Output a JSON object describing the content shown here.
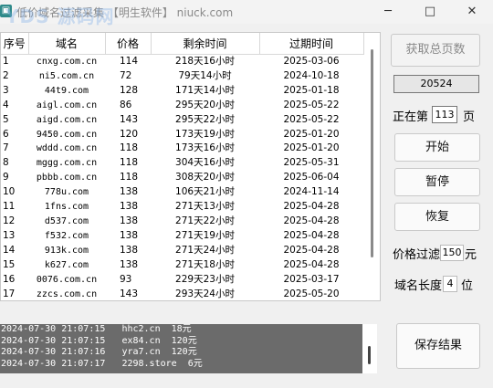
{
  "window": {
    "icon": "app-icon",
    "title": "低价域名过滤采集 【明生软件】 niuck.com",
    "watermark": "YDS 源码网",
    "min_glyph": "─",
    "max_glyph": "□",
    "close_glyph": "✕"
  },
  "table": {
    "headers": [
      "序号",
      "域名",
      "价格",
      "剩余时间",
      "过期时间"
    ],
    "rows": [
      [
        "1",
        "cnxg.com.cn",
        "114",
        "218天16小时",
        "2025-03-06"
      ],
      [
        "2",
        "ni5.com.cn",
        "72",
        "79天14小时",
        "2024-10-18"
      ],
      [
        "3",
        "44t9.com",
        "128",
        "171天14小时",
        "2025-01-18"
      ],
      [
        "4",
        "aigl.com.cn",
        "86",
        "295天20小时",
        "2025-05-22"
      ],
      [
        "5",
        "aigd.com.cn",
        "143",
        "295天22小时",
        "2025-05-22"
      ],
      [
        "6",
        "9450.com.cn",
        "120",
        "173天19小时",
        "2025-01-20"
      ],
      [
        "7",
        "wddd.com.cn",
        "118",
        "173天16小时",
        "2025-01-20"
      ],
      [
        "8",
        "mggg.com.cn",
        "118",
        "304天16小时",
        "2025-05-31"
      ],
      [
        "9",
        "pbbb.com.cn",
        "118",
        "308天20小时",
        "2025-06-04"
      ],
      [
        "10",
        "778u.com",
        "138",
        "106天21小时",
        "2024-11-14"
      ],
      [
        "11",
        "1fns.com",
        "138",
        "271天13小时",
        "2025-04-28"
      ],
      [
        "12",
        "d537.com",
        "138",
        "271天22小时",
        "2025-04-28"
      ],
      [
        "13",
        "f532.com",
        "138",
        "271天19小时",
        "2025-04-28"
      ],
      [
        "14",
        "913k.com",
        "138",
        "271天24小时",
        "2025-04-28"
      ],
      [
        "15",
        "k627.com",
        "138",
        "271天18小时",
        "2025-04-28"
      ],
      [
        "16",
        "0076.com.cn",
        "93",
        "229天23小时",
        "2025-03-17"
      ],
      [
        "17",
        "zzcs.com.cn",
        "143",
        "293天24小时",
        "2025-05-20"
      ]
    ]
  },
  "log": {
    "lines": [
      "2024-07-30 21:07:15   hhc2.cn  18元",
      "2024-07-30 21:07:15   ex84.cn  120元",
      "2024-07-30 21:07:16   yra7.cn  120元",
      "2024-07-30 21:07:17   2298.store  6元"
    ]
  },
  "controls": {
    "get_total_label": "获取总页数",
    "total_pages": "20524",
    "current_page_prefix": "正在第",
    "current_page": "113",
    "current_page_suffix": "页",
    "start_label": "开始",
    "pause_label": "暂停",
    "resume_label": "恢复",
    "price_filter_label": "价格过滤",
    "price_filter_value": "150",
    "price_filter_unit": "元",
    "domain_length_label": "域名长度",
    "domain_length_value": "4",
    "domain_length_unit": "位",
    "save_label": "保存结果"
  }
}
